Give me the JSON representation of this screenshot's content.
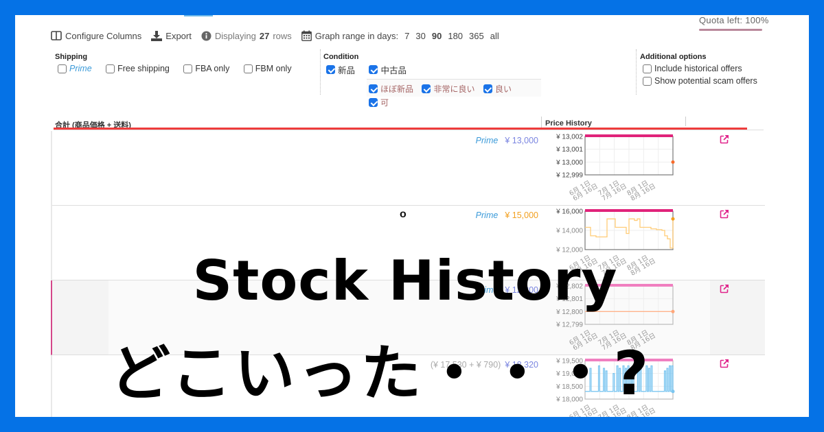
{
  "toolbar": {
    "configure_columns": "Configure Columns",
    "export": "Export",
    "displaying_prefix": "Displaying",
    "row_count": "27",
    "displaying_suffix": "rows",
    "graph_range_label": "Graph range in days:",
    "ranges": [
      "7",
      "30",
      "90",
      "180",
      "365",
      "all"
    ],
    "selected_range": "90",
    "quota": "Quota left: 100%"
  },
  "filters": {
    "shipping": {
      "title": "Shipping",
      "options": [
        {
          "label": "Prime",
          "checked": false
        },
        {
          "label": "Free shipping",
          "checked": false
        },
        {
          "label": "FBA only",
          "checked": false
        },
        {
          "label": "FBM only",
          "checked": false
        }
      ]
    },
    "condition": {
      "title": "Condition",
      "options": [
        {
          "label": "新品",
          "checked": true
        },
        {
          "label": "中古品",
          "checked": true
        }
      ],
      "used_sub_options": [
        {
          "label": "ほぼ新品",
          "checked": true
        },
        {
          "label": "非常に良い",
          "checked": true
        },
        {
          "label": "良い",
          "checked": true
        },
        {
          "label": "可",
          "checked": true
        }
      ]
    },
    "additional": {
      "title": "Additional options",
      "options": [
        {
          "label": "Include historical offers",
          "checked": false
        },
        {
          "label": "Show potential scam offers",
          "checked": false
        }
      ]
    }
  },
  "table": {
    "headers": [
      "合計 (商品価格 + 送料)",
      "Price History"
    ],
    "rows": [
      {
        "prime": "Prime",
        "breakdown": "",
        "total": "¥ 13,000",
        "marker": "",
        "chart": {
          "yticks": [
            "¥ 13,002",
            "¥ 13,001",
            "¥ 13,000",
            "¥ 12,999"
          ],
          "ylim": [
            12999,
            13002
          ],
          "series": [
            13000,
            13000
          ],
          "color": "#f77f3b",
          "stock_bar": "#e0237a",
          "endpoint_only": true
        }
      },
      {
        "prime": "Prime",
        "breakdown": "",
        "total": "¥ 15,000",
        "marker": "o",
        "chart": {
          "yticks": [
            "¥ 16,000",
            "¥ 14,000",
            "¥ 12,000"
          ],
          "ylim": [
            11000,
            16000
          ],
          "series": [
            13900,
            13900,
            12800,
            12800,
            12650,
            12650,
            12650,
            12650,
            15000,
            15000,
            15000,
            13900,
            13900,
            13900,
            13900,
            13100,
            15000,
            15000,
            14800,
            15000,
            13900,
            13900,
            13900,
            13900,
            13700,
            13700,
            13600,
            13600,
            13500,
            12800,
            12400,
            11200,
            15000
          ],
          "color": "#ffcc77",
          "stock_bar": "#e0237a",
          "endpoint_only": false
        }
      },
      {
        "prime": "Prime",
        "breakdown": "",
        "total": "¥ 12,800",
        "marker": "",
        "chart": {
          "yticks": [
            "¥ 12,802",
            "¥ 12,801",
            "¥ 12,800",
            "¥ 12,799"
          ],
          "ylim": [
            12799,
            12802
          ],
          "series": [
            12800,
            12800
          ],
          "color": "#ffb38a",
          "stock_bar": "#f07fc0",
          "endpoint_only": false
        }
      },
      {
        "prime": "",
        "breakdown": "(¥ 17,530 + ¥ 790)",
        "total": "¥ 18,320",
        "marker": "",
        "chart": {
          "yticks": [
            "¥ 19,500",
            "¥ 19,000",
            "¥ 18,500",
            "¥ 18,000"
          ],
          "ylim": [
            18000,
            19500
          ],
          "series": [
            18300,
            18300,
            18300,
            18300,
            19200,
            18300,
            18300,
            18300,
            18300,
            18300,
            18300,
            19300,
            18300,
            18300,
            18300,
            19200,
            18300,
            19100,
            18300,
            18300,
            18300,
            18300,
            18300,
            19000,
            18300,
            18300,
            19300,
            18300,
            19200,
            18300,
            18300,
            19300,
            18300,
            19200,
            18300,
            19300,
            18300,
            19200,
            18300,
            19300,
            18300,
            18300,
            18300,
            19200,
            18300,
            19200,
            18300,
            18300,
            18300,
            18300,
            19300,
            18300,
            19200,
            18300,
            19300,
            18300,
            18300,
            18300,
            18300,
            18300,
            18300,
            18300,
            18300,
            18300,
            18300,
            19100,
            18300,
            19200,
            18300,
            19300,
            18300,
            19300,
            18300
          ],
          "color": "#7cc6f0",
          "stock_bar": "#f07fc0",
          "endpoint_only": false
        }
      }
    ],
    "x_ticks": [
      "6月 1日",
      "6月 16日",
      "7月 1日",
      "7月 16日",
      "8月 1日",
      "8月 16日"
    ]
  },
  "overlay": {
    "line1": "Stock History",
    "line2": "どこいった・・・?"
  }
}
